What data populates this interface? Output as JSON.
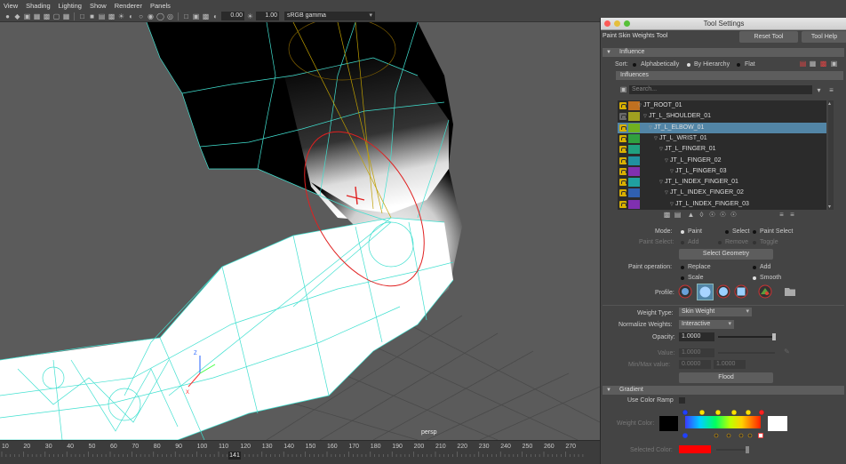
{
  "viewport": {
    "menu": [
      "View",
      "Shading",
      "Lighting",
      "Show",
      "Renderer",
      "Panels"
    ],
    "exposure": "0.00",
    "gamma": "1.00",
    "colorspace": "sRGB gamma",
    "camera_label": "persp"
  },
  "timeline": {
    "ticks": [
      "10",
      "20",
      "30",
      "40",
      "50",
      "60",
      "70",
      "80",
      "90",
      "100",
      "110",
      "120",
      "130",
      "140",
      "150",
      "160",
      "170",
      "180",
      "190",
      "200",
      "210",
      "220",
      "230",
      "240",
      "250",
      "260",
      "270"
    ],
    "current_frame": "141"
  },
  "panel": {
    "window_title": "Tool Settings",
    "tool_name": "Paint Skin Weights Tool",
    "reset_label": "Reset Tool",
    "help_label": "Tool Help",
    "influence_section": "Influence",
    "sort_label": "Sort:",
    "sort_options": [
      "Alphabetically",
      "By Hierarchy",
      "Flat"
    ],
    "sort_selected": 1,
    "influences_label": "Influences",
    "search_placeholder": "Search...",
    "influences": [
      {
        "name": "JT_ROOT_01",
        "depth": 0,
        "color": "#c07020",
        "selected": false
      },
      {
        "name": "JT_L_SHOULDER_01",
        "depth": 1,
        "color": "#a0a020",
        "selected": false
      },
      {
        "name": "JT_L_ELBOW_01",
        "depth": 2,
        "color": "#70b020",
        "selected": true
      },
      {
        "name": "JT_L_WRIST_01",
        "depth": 3,
        "color": "#30a040",
        "selected": false
      },
      {
        "name": "JT_L_FINGER_01",
        "depth": 4,
        "color": "#20a080",
        "selected": false
      },
      {
        "name": "JT_L_FINGER_02",
        "depth": 5,
        "color": "#2090a0",
        "selected": false
      },
      {
        "name": "JT_L_FINGER_03",
        "depth": 6,
        "color": "#8030b0",
        "selected": false
      },
      {
        "name": "JT_L_INDEX_FINGER_01",
        "depth": 4,
        "color": "#20a0a0",
        "selected": false
      },
      {
        "name": "JT_L_INDEX_FINGER_02",
        "depth": 5,
        "color": "#3060b0",
        "selected": false
      },
      {
        "name": "JT_L_INDEX_FINGER_03",
        "depth": 6,
        "color": "#8030b0",
        "selected": false
      }
    ],
    "mode_label": "Mode:",
    "mode_options": [
      "Paint",
      "Select",
      "Paint Select"
    ],
    "mode_selected": 0,
    "paint_select_label": "Paint Select:",
    "paint_select_options": [
      "Add",
      "Remove",
      "Toggle"
    ],
    "select_geometry_label": "Select Geometry",
    "paint_op_label": "Paint operation:",
    "paint_ops": [
      "Replace",
      "Add",
      "Scale",
      "Smooth"
    ],
    "paint_op_selected": 3,
    "profile_label": "Profile:",
    "weight_type_label": "Weight Type:",
    "weight_type_value": "Skin Weight",
    "normalize_label": "Normalize Weights:",
    "normalize_value": "Interactive",
    "opacity_label": "Opacity:",
    "opacity_value": "1.0000",
    "value_label": "Value:",
    "value_value": "1.0000",
    "minmax_label": "Min/Max value:",
    "min_value": "0.0000",
    "max_value": "1.0000",
    "flood_label": "Flood",
    "gradient_section": "Gradient",
    "use_color_ramp_label": "Use Color Ramp",
    "weight_color_label": "Weight Color:",
    "selected_color_label": "Selected Color:",
    "colors": {
      "accent": "#5285a6",
      "selected_color": "#ff0000"
    }
  }
}
